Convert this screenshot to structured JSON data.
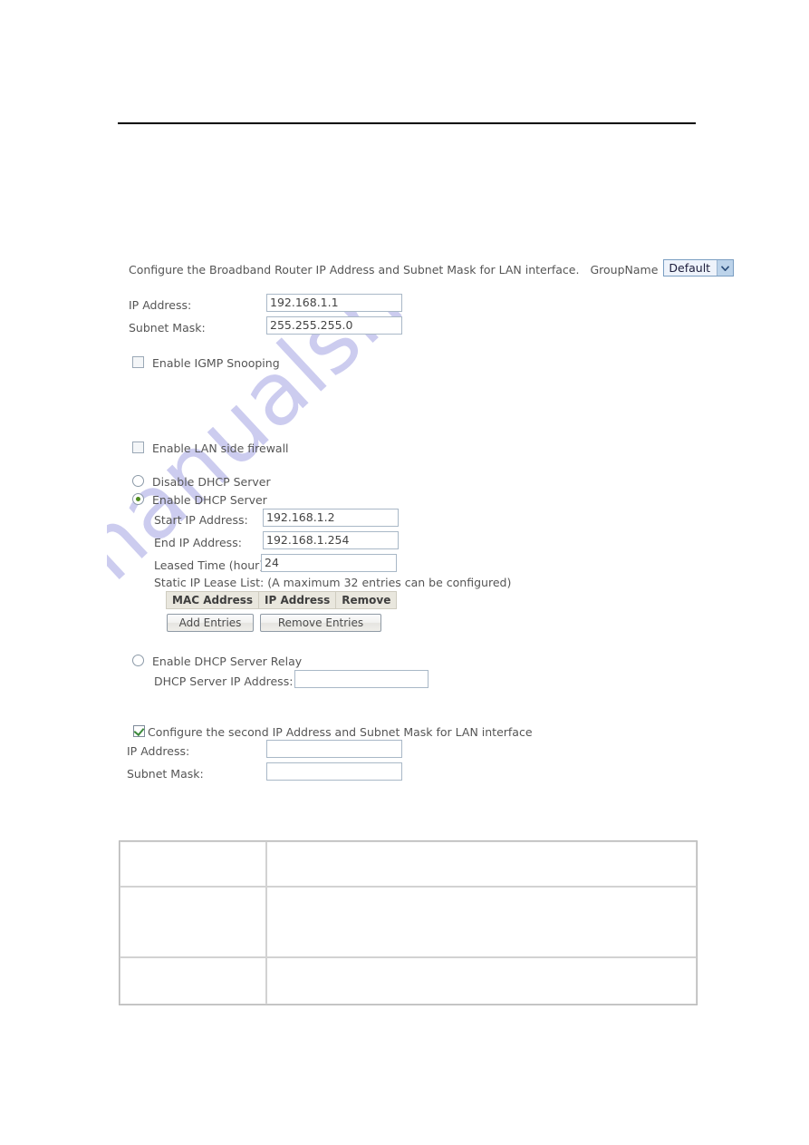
{
  "page": {
    "background_color": "#ffffff",
    "text_color": "#555555"
  },
  "watermark": {
    "text": "manualshive.com",
    "color": "#ccccef",
    "rotation_deg": -43
  },
  "divider": {
    "name": "top-horizontal-rule",
    "color": "#000000"
  },
  "intro": {
    "description": "Configure the Broadband Router IP Address and Subnet Mask for LAN interface.",
    "group_name_label": "GroupName",
    "group_name_select": {
      "selected": "Default",
      "options": [
        "Default"
      ],
      "arrow_icon": "chevron-down-icon",
      "bg_color": "#eef3fb",
      "border_color": "#7a9ec2"
    }
  },
  "lan": {
    "ip_address_label": "IP Address:",
    "ip_address_value": "192.168.1.1",
    "subnet_mask_label": "Subnet Mask:",
    "subnet_mask_value": "255.255.255.0"
  },
  "igmp": {
    "label": "Enable IGMP Snooping",
    "checked": false
  },
  "lan_firewall": {
    "label": "Enable LAN side firewall",
    "checked": false
  },
  "dhcp": {
    "disable_label": "Disable DHCP Server",
    "disable_selected": false,
    "enable_label": "Enable DHCP Server",
    "enable_selected": true,
    "selected_dot_color": "#4e8c1f",
    "start_ip_label": "Start IP Address:",
    "start_ip_value": "192.168.1.2",
    "end_ip_label": "End IP Address:",
    "end_ip_value": "192.168.1.254",
    "leased_time_label": "Leased Time (hour):",
    "leased_time_value": "24",
    "static_lease_label": "Static IP Lease List: (A maximum 32 entries can be configured)",
    "lease_table": {
      "headers": [
        "MAC Address",
        "IP Address",
        "Remove"
      ],
      "rows": []
    },
    "add_entries_button": "Add Entries",
    "remove_entries_button": "Remove Entries",
    "relay_label": "Enable DHCP Server Relay",
    "relay_selected": false,
    "relay_ip_label": "DHCP Server IP Address:",
    "relay_ip_value": ""
  },
  "second_ip": {
    "checkbox_label": "Configure the second IP Address and Subnet Mask for LAN interface",
    "checked": true,
    "check_color": "#3d8b3d",
    "ip_address_label": "IP Address:",
    "ip_address_value": "",
    "subnet_mask_label": "Subnet Mask:",
    "subnet_mask_value": ""
  },
  "bottom_table": {
    "border_color": "#b9b9b9",
    "rows": [
      {
        "col_a": "",
        "col_b": ""
      },
      {
        "col_a": "",
        "col_b": ""
      },
      {
        "col_a": "",
        "col_b": ""
      }
    ]
  }
}
